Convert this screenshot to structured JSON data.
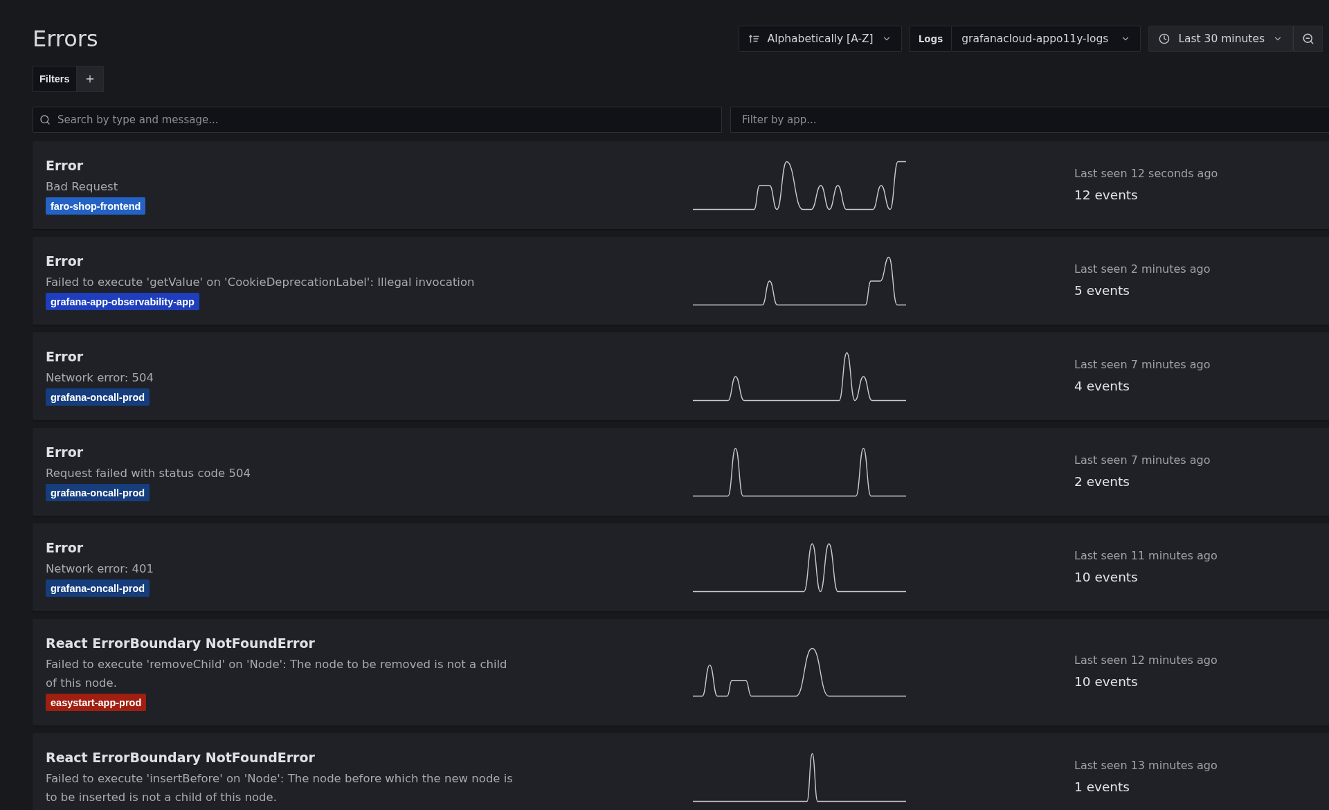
{
  "page": {
    "title": "Errors"
  },
  "toolbar": {
    "sort": {
      "value": "Alphabetically [A-Z]"
    },
    "data_source": {
      "label": "Logs",
      "value": "grafanacloud-appo11y-logs"
    },
    "time_range": {
      "value": "Last 30 minutes"
    }
  },
  "filters": {
    "label": "Filters"
  },
  "search": {
    "placeholder": "Search by type and message..."
  },
  "app_filter": {
    "placeholder": "Filter by app..."
  },
  "errors": [
    {
      "type": "Error",
      "message": "Bad Request",
      "app": {
        "name": "faro-shop-frontend",
        "color": "#2463c5"
      },
      "last_seen": "Last seen 12 seconds ago",
      "events": "12 events"
    },
    {
      "type": "Error",
      "message": "Failed to execute 'getValue' on 'CookieDeprecationLabel': Illegal invocation",
      "app": {
        "name": "grafana-app-observability-app",
        "color": "#1e3ebd"
      },
      "last_seen": "Last seen 2 minutes ago",
      "events": "5 events"
    },
    {
      "type": "Error",
      "message": "Network error: 504",
      "app": {
        "name": "grafana-oncall-prod",
        "color": "#163d7c"
      },
      "last_seen": "Last seen 7 minutes ago",
      "events": "4 events"
    },
    {
      "type": "Error",
      "message": "Request failed with status code 504",
      "app": {
        "name": "grafana-oncall-prod",
        "color": "#163d7c"
      },
      "last_seen": "Last seen 7 minutes ago",
      "events": "2 events"
    },
    {
      "type": "Error",
      "message": "Network error: 401",
      "app": {
        "name": "grafana-oncall-prod",
        "color": "#163d7c"
      },
      "last_seen": "Last seen 11 minutes ago",
      "events": "10 events"
    },
    {
      "type": "React ErrorBoundary NotFoundError",
      "message": "Failed to execute 'removeChild' on 'Node': The node to be removed is not a child of this node.",
      "app": {
        "name": "easystart-app-prod",
        "color": "#a01f10"
      },
      "last_seen": "Last seen 12 minutes ago",
      "events": "10 events"
    },
    {
      "type": "React ErrorBoundary NotFoundError",
      "message": "Failed to execute 'insertBefore' on 'Node': The node before which the new node is to be inserted is not a child of this node.",
      "last_seen": "Last seen 13 minutes ago",
      "events": "1 events"
    }
  ]
}
